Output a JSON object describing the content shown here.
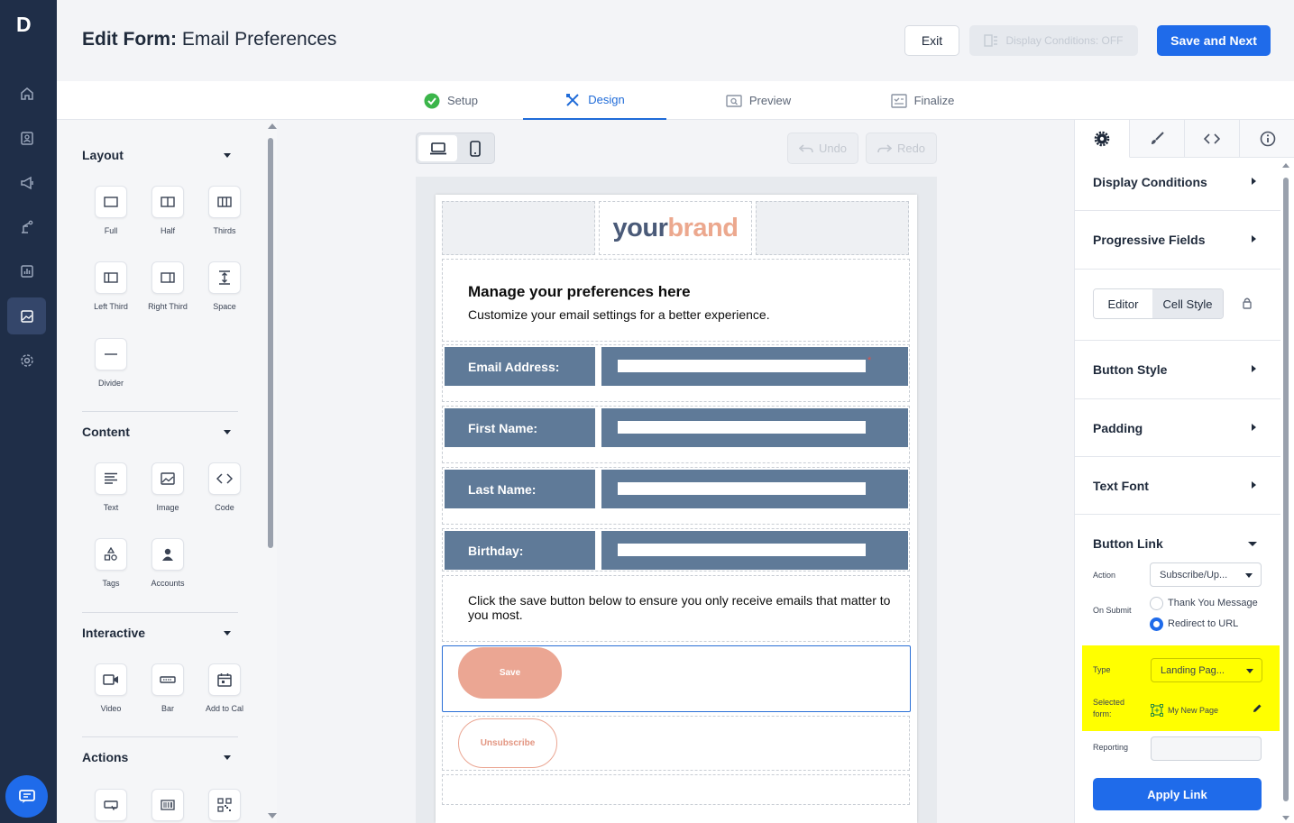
{
  "nav": {
    "logo": "D",
    "items": [
      "home",
      "contacts",
      "campaigns",
      "automation",
      "reports",
      "content",
      "settings"
    ],
    "active": "content"
  },
  "header": {
    "title_bold": "Edit Form:",
    "title_rest": " Email Preferences",
    "exit_label": "Exit",
    "display_conditions_label": "Display Conditions: OFF",
    "save_next_label": "Save and Next"
  },
  "tabs": [
    {
      "label": "Setup",
      "state": "complete"
    },
    {
      "label": "Design",
      "state": "active"
    },
    {
      "label": "Preview",
      "state": "inactive"
    },
    {
      "label": "Finalize",
      "state": "inactive"
    }
  ],
  "left": {
    "layout": {
      "title": "Layout",
      "items": [
        "Full",
        "Half",
        "Thirds",
        "Left Third",
        "Right Third",
        "Space",
        "Divider"
      ]
    },
    "content": {
      "title": "Content",
      "items": [
        "Text",
        "Image",
        "Code",
        "Tags",
        "Accounts"
      ]
    },
    "interactive": {
      "title": "Interactive",
      "items": [
        "Video",
        "Bar",
        "Add to Cal"
      ]
    },
    "actions": {
      "title": "Actions"
    }
  },
  "toolbar": {
    "undo": "Undo",
    "redo": "Redo"
  },
  "form": {
    "brand_a": "your",
    "brand_b": "brand",
    "heading": "Manage your preferences here",
    "subheading": "Customize your email settings for a better experience.",
    "fields": [
      {
        "label": "Email Address:",
        "required": true,
        "required_mark": "*"
      },
      {
        "label": "First Name:",
        "required": false
      },
      {
        "label": "Last Name:",
        "required": false
      },
      {
        "label": "Birthday:",
        "required": false
      }
    ],
    "note": "Click the save button below to ensure you only receive emails that matter to you most.",
    "save_label": "Save",
    "unsubscribe_label": "Unsubscribe",
    "colors": {
      "field_bg": "#5f7a98",
      "save_bg": "#eba693",
      "unsub_border": "#eba693",
      "brand_a": "#4a5a78",
      "brand_b": "#eca88e"
    }
  },
  "right": {
    "sections": [
      "Display Conditions",
      "Progressive Fields",
      "Button Style",
      "Padding",
      "Text Font",
      "Button Link"
    ],
    "toggle": {
      "editor": "Editor",
      "cell_style": "Cell Style"
    },
    "action_label": "Action",
    "action_value": "Subscribe/Up...",
    "on_submit_label": "On Submit",
    "on_submit_options": [
      "Thank You Message",
      "Redirect to URL"
    ],
    "on_submit_selected": "Redirect to URL",
    "type_label": "Type",
    "type_value": "Landing Pag...",
    "selected_form_label_1": "Selected",
    "selected_form_label_2": "form:",
    "selected_form_value": "My New Page",
    "reporting_label": "Reporting",
    "reporting_value": "",
    "apply_label": "Apply Link",
    "highlight_color": "#ffff00",
    "accent": "#1f6bea"
  }
}
